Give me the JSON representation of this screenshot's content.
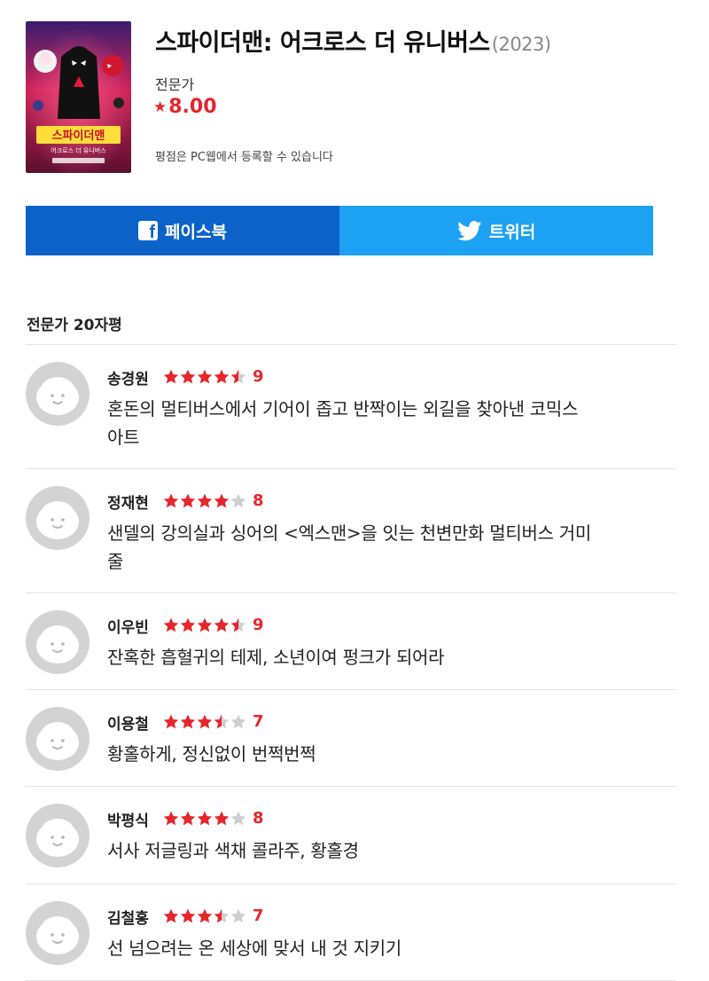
{
  "movie": {
    "title": "스파이더맨: 어크로스 더 유니버스",
    "year": "(2023)",
    "score_label": "전문가",
    "score_star": "★",
    "score": "8.00",
    "rating_note": "평점은 PC웹에서 등록할 수 있습니다",
    "poster": {
      "title_text": "스파이더맨",
      "subtitle_text": "어크로스 더 유니버스"
    }
  },
  "share": {
    "facebook_label": "페이스북",
    "twitter_label": "트위터",
    "facebook_color": "#0b62c9",
    "twitter_color": "#1da1f2"
  },
  "reviews_section": {
    "title": "전문가 20자평"
  },
  "accent_color": "#e5262b",
  "reviews": [
    {
      "name": "송경원",
      "score": "9",
      "stars": 4.5,
      "text_lines": [
        "혼돈의 멀티버스에서 기어이 좁고 반짝이는 외길을 찾아낸 코믹스",
        "아트"
      ]
    },
    {
      "name": "정재현",
      "score": "8",
      "stars": 4,
      "text_lines": [
        "샌델의 강의실과 싱어의 <엑스맨>을 잇는 천변만화 멀티버스 거미",
        "줄"
      ]
    },
    {
      "name": "이우빈",
      "score": "9",
      "stars": 4.5,
      "text_lines": [
        "잔혹한 흡혈귀의 테제, 소년이여 펑크가 되어라"
      ]
    },
    {
      "name": "이용철",
      "score": "7",
      "stars": 3.5,
      "text_lines": [
        "황홀하게, 정신없이 번쩍번쩍"
      ]
    },
    {
      "name": "박평식",
      "score": "8",
      "stars": 4,
      "text_lines": [
        "서사 저글링과 색채 콜라주, 황홀경"
      ]
    },
    {
      "name": "김철홍",
      "score": "7",
      "stars": 3.5,
      "text_lines": [
        "선 넘으려는 온 세상에 맞서 내 것 지키기"
      ]
    }
  ]
}
